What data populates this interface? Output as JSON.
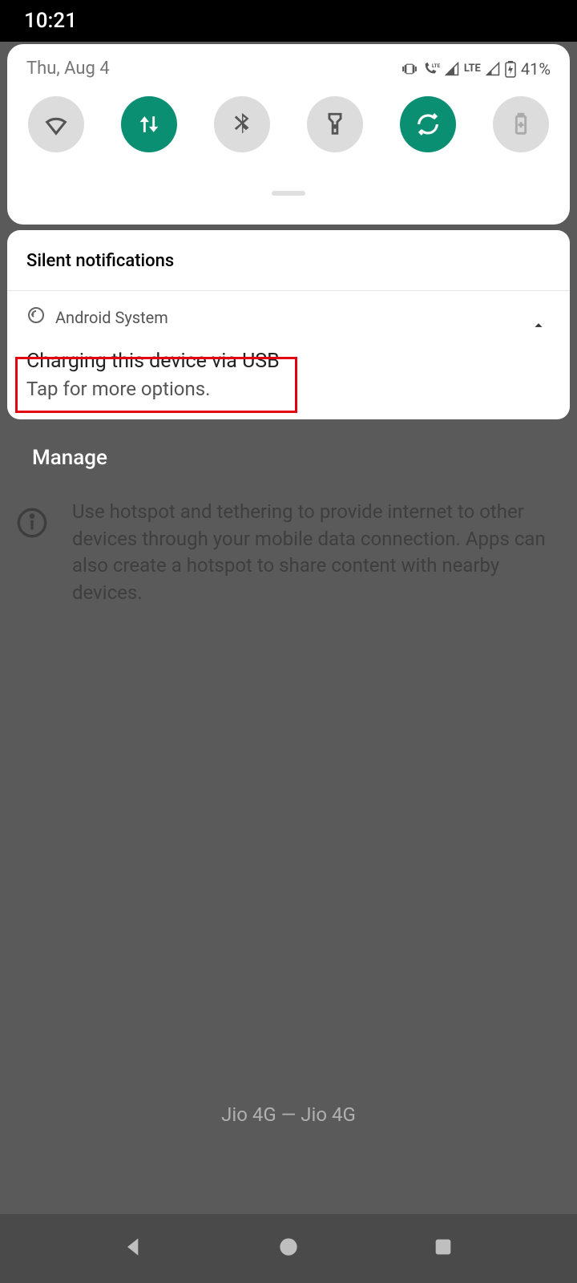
{
  "statusbar": {
    "time": "10:21"
  },
  "panel": {
    "date": "Thu, Aug 4",
    "battery_pct": "41%",
    "tiles": [
      {
        "name": "wifi",
        "active": false
      },
      {
        "name": "mobile-data",
        "active": true
      },
      {
        "name": "bluetooth",
        "active": false
      },
      {
        "name": "flashlight",
        "active": false
      },
      {
        "name": "auto-rotate",
        "active": true
      },
      {
        "name": "battery-saver",
        "active": false
      }
    ]
  },
  "notifications": {
    "section_title": "Silent notifications",
    "items": [
      {
        "app": "Android System",
        "title": "Charging this device via USB",
        "body": "Tap for more options."
      }
    ]
  },
  "manage_label": "Manage",
  "background": {
    "info_text": "Use hotspot and tethering to provide internet to other devices through your mobile data connection. Apps can also create a hotspot to share content with nearby devices.",
    "carrier": "Jio 4G — Jio 4G"
  }
}
